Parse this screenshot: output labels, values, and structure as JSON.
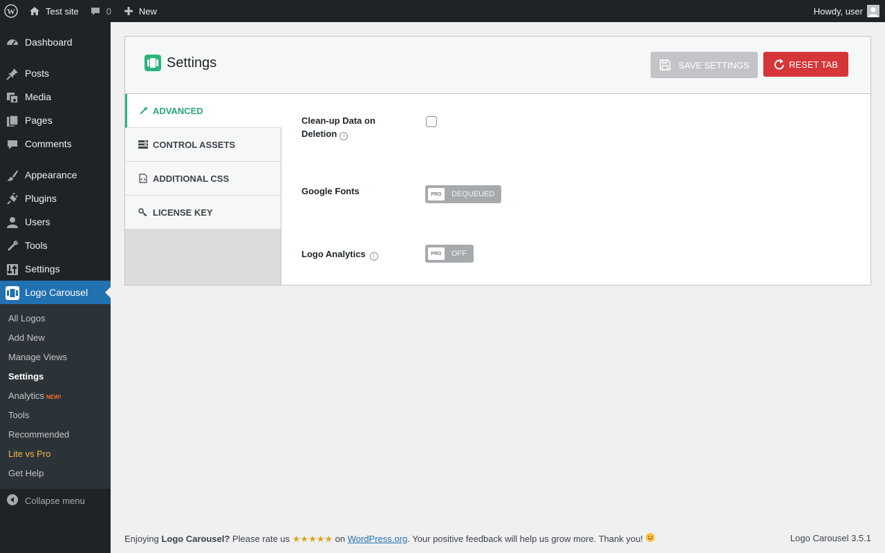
{
  "admin_bar": {
    "site_name": "Test site",
    "comments_count": "0",
    "new_label": "New",
    "howdy": "Howdy, user"
  },
  "sidebar": {
    "items": [
      {
        "label": "Dashboard",
        "icon": "dashboard-icon"
      },
      {
        "label": "Posts",
        "icon": "pin-icon"
      },
      {
        "label": "Media",
        "icon": "media-icon"
      },
      {
        "label": "Pages",
        "icon": "pages-icon"
      },
      {
        "label": "Comments",
        "icon": "comment-icon"
      },
      {
        "label": "Appearance",
        "icon": "brush-icon"
      },
      {
        "label": "Plugins",
        "icon": "plugin-icon"
      },
      {
        "label": "Users",
        "icon": "user-icon"
      },
      {
        "label": "Tools",
        "icon": "wrench-icon"
      },
      {
        "label": "Settings",
        "icon": "settings-icon"
      },
      {
        "label": "Logo Carousel",
        "icon": "carousel-icon"
      }
    ],
    "submenu": [
      {
        "label": "All Logos"
      },
      {
        "label": "Add New"
      },
      {
        "label": "Manage Views"
      },
      {
        "label": "Settings"
      },
      {
        "label": "Analytics",
        "badge": "NEW!"
      },
      {
        "label": "Tools"
      },
      {
        "label": "Recommended"
      },
      {
        "label": "Lite vs Pro"
      },
      {
        "label": "Get Help"
      }
    ],
    "collapse": "Collapse menu"
  },
  "panel": {
    "title": "Settings",
    "save_label": "SAVE SETTINGS",
    "reset_label": "RESET TAB",
    "tabs": [
      {
        "label": "ADVANCED",
        "icon": "wrench-icon"
      },
      {
        "label": "CONTROL ASSETS",
        "icon": "list-icon"
      },
      {
        "label": "ADDITIONAL CSS",
        "icon": "code-file-icon"
      },
      {
        "label": "LICENSE KEY",
        "icon": "key-icon"
      }
    ],
    "fields": {
      "cleanup_line1": "Clean-up Data on",
      "cleanup_line2": "Deletion",
      "google_fonts": "Google Fonts",
      "google_fonts_state": "DEQUEUED",
      "logo_analytics": "Logo Analytics",
      "logo_analytics_state": "OFF",
      "pro_badge": "PRO",
      "info_glyph": "i"
    }
  },
  "footer": {
    "enjoying": "Enjoying ",
    "plugin_name": "Logo Carousel?",
    "rate_us": " Please rate us ",
    "stars": "★★★★★",
    "on": " on ",
    "link": "WordPress.org",
    "rest": ". Your positive feedback will help us grow more. Thank you! ",
    "version": "Logo Carousel 3.5.1"
  },
  "colors": {
    "accent": "#2271b1",
    "brand_green": "#29b57b",
    "danger": "#d63638",
    "admin_dark": "#1d2327"
  }
}
